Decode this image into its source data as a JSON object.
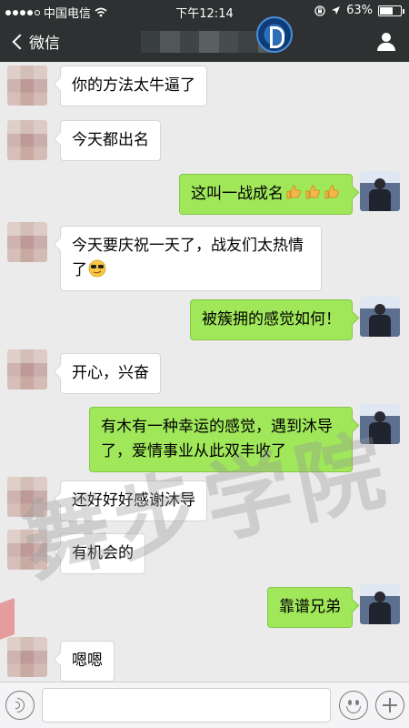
{
  "status_bar": {
    "carrier": "中国电信",
    "time": "下午12:14",
    "battery": "63%",
    "battery_level": 0.63,
    "signal_filled": 4,
    "signal_total": 5
  },
  "nav": {
    "back_label": "微信",
    "title_mosaic_colors": [
      "#3a3f40",
      "#505758",
      "#3f4546",
      "#5a6061",
      "#474d4e",
      "#3c4142",
      "#565c5d"
    ]
  },
  "messages": [
    {
      "side": "other",
      "text": "你的方法太牛逼了"
    },
    {
      "side": "other",
      "text": "今天都出名"
    },
    {
      "side": "self",
      "text": "这叫一战成名",
      "emoji": [
        "thumbs-up",
        "thumbs-up",
        "thumbs-up"
      ]
    },
    {
      "side": "other",
      "text": "今天要庆祝一天了，战友们太热情了",
      "emoji": [
        "sunglasses"
      ]
    },
    {
      "side": "self",
      "text": "被簇拥的感觉如何！"
    },
    {
      "side": "other",
      "text": "开心，兴奋"
    },
    {
      "side": "self",
      "text": "有木有一种幸运的感觉，遇到沐导了，爱情事业从此双丰收了"
    },
    {
      "side": "other",
      "text": "还好好好感谢沐导"
    },
    {
      "side": "other",
      "text": "有机会的"
    },
    {
      "side": "self",
      "text": "靠谱兄弟"
    },
    {
      "side": "other",
      "text": "嗯嗯"
    }
  ],
  "watermark": "舞步学院",
  "input_bar": {
    "value": "",
    "icons": [
      "voice-icon",
      "emoji-icon",
      "plus-icon"
    ]
  },
  "colors": {
    "header": "#2e3132",
    "chat_bg": "#ebebeb",
    "self_bubble": "#a0e75a",
    "other_bubble": "#ffffff"
  }
}
